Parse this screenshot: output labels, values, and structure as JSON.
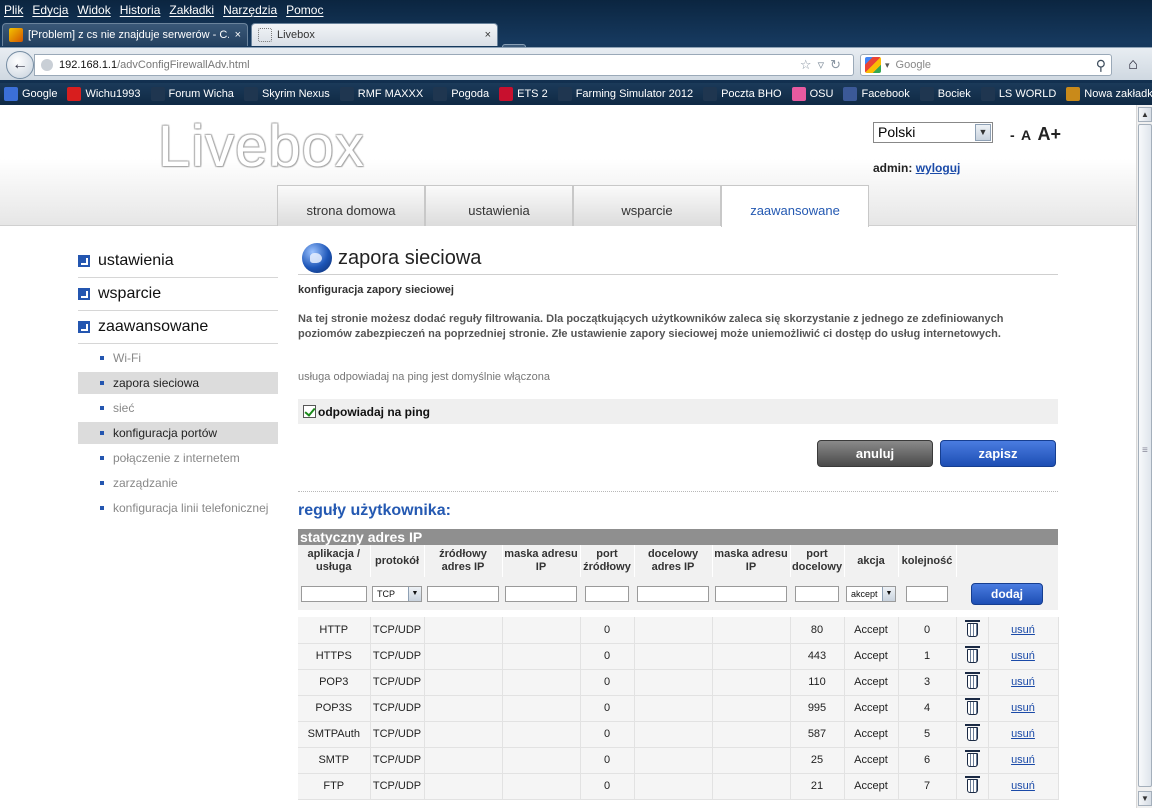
{
  "browser": {
    "menu": [
      "Plik",
      "Edycja",
      "Widok",
      "Historia",
      "Zakładki",
      "Narzędzia",
      "Pomoc"
    ],
    "tabs": [
      {
        "title": "[Problem] z cs nie znajduje serwerów - C...",
        "close": "×"
      },
      {
        "title": "Livebox",
        "close": "×"
      }
    ],
    "newtab": "+",
    "url_host": "192.168.1.1",
    "url_path": "/advConfigFirewallAdv.html",
    "search_placeholder": "Google",
    "bookmarks": [
      {
        "label": "Google",
        "color": "#3b6fd8"
      },
      {
        "label": "Wichu1993",
        "color": "#d81e1e"
      },
      {
        "label": "Forum Wicha",
        "color": "#1f3650"
      },
      {
        "label": "Skyrim Nexus",
        "color": "#1f3650"
      },
      {
        "label": "RMF MAXXX",
        "color": "#1f3650"
      },
      {
        "label": "Pogoda",
        "color": "#1f3650"
      },
      {
        "label": "ETS 2",
        "color": "#c8102e"
      },
      {
        "label": "Farming Simulator 2012",
        "color": "#1f3650"
      },
      {
        "label": "Poczta BHO",
        "color": "#1f3650"
      },
      {
        "label": "OSU",
        "color": "#e85aa0"
      },
      {
        "label": "Facebook",
        "color": "#3b5998"
      },
      {
        "label": "Bociek",
        "color": "#1f3650"
      },
      {
        "label": "LS WORLD",
        "color": "#1f3650"
      },
      {
        "label": "Nowa zakładka",
        "color": "#c98a1a"
      }
    ]
  },
  "header": {
    "logo": "Livebox",
    "language": "Polski",
    "font_small": "-",
    "font_a": "A",
    "font_big": "A+",
    "admin_label": "admin:",
    "logout": "wyloguj",
    "nav": [
      "strona domowa",
      "ustawienia",
      "wsparcie",
      "zaawansowane"
    ]
  },
  "sidebar": {
    "sections": [
      "ustawienia",
      "wsparcie",
      "zaawansowane"
    ],
    "items": [
      {
        "label": "Wi-Fi"
      },
      {
        "label": "zapora sieciowa"
      },
      {
        "label": "sieć"
      },
      {
        "label": "konfiguracja portów"
      },
      {
        "label": "połączenie z internetem"
      },
      {
        "label": "zarządzanie"
      },
      {
        "label": "konfiguracja linii telefonicznej"
      }
    ]
  },
  "main": {
    "title": "zapora sieciowa",
    "subtitle": "konfiguracja zapory sieciowej",
    "description": "Na tej stronie możesz dodać reguły filtrowania. Dla początkujących użytkowników zaleca się skorzystanie z jednego ze zdefiniowanych poziomów zabezpieczeń na poprzedniej stronie. Złe ustawienie zapory sieciowej może uniemożliwić ci dostęp do usług internetowych.",
    "ping_info": "usługa odpowiadaj na ping jest domyślnie włączona",
    "ping_label": "odpowiadaj na ping",
    "cancel": "anuluj",
    "save": "zapisz",
    "rules_title": "reguły użytkownika:",
    "table_title": "statyczny adres IP",
    "columns": [
      "aplikacja / usługa",
      "protokół",
      "źródłowy adres IP",
      "maska adresu IP",
      "port źródłowy",
      "docelowy adres IP",
      "maska adresu IP",
      "port docelowy",
      "akcja",
      "kolejność"
    ],
    "protocol_default": "TCP",
    "action_default": "akcept",
    "add": "dodaj",
    "delete_label": "usuń",
    "rows": [
      {
        "app": "HTTP",
        "proto": "TCP/UDP",
        "sport": "0",
        "dport": "80",
        "action": "Accept",
        "order": "0"
      },
      {
        "app": "HTTPS",
        "proto": "TCP/UDP",
        "sport": "0",
        "dport": "443",
        "action": "Accept",
        "order": "1"
      },
      {
        "app": "POP3",
        "proto": "TCP/UDP",
        "sport": "0",
        "dport": "110",
        "action": "Accept",
        "order": "3"
      },
      {
        "app": "POP3S",
        "proto": "TCP/UDP",
        "sport": "0",
        "dport": "995",
        "action": "Accept",
        "order": "4"
      },
      {
        "app": "SMTPAuth",
        "proto": "TCP/UDP",
        "sport": "0",
        "dport": "587",
        "action": "Accept",
        "order": "5"
      },
      {
        "app": "SMTP",
        "proto": "TCP/UDP",
        "sport": "0",
        "dport": "25",
        "action": "Accept",
        "order": "6"
      },
      {
        "app": "FTP",
        "proto": "TCP/UDP",
        "sport": "0",
        "dport": "21",
        "action": "Accept",
        "order": "7"
      }
    ]
  },
  "colors": {
    "accent": "#2459b2",
    "save_button": "#1d4eb4",
    "cancel_button": "#4a4a4a"
  }
}
